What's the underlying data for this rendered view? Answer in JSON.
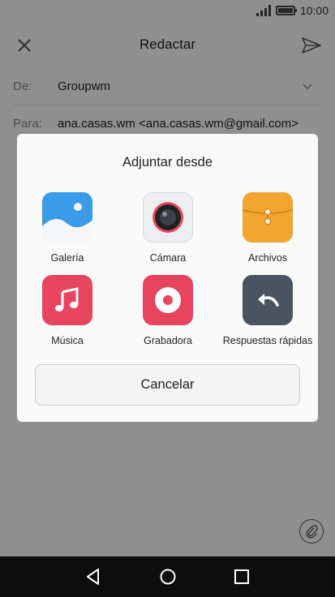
{
  "status_bar": {
    "time": "10:00"
  },
  "app_bar": {
    "title": "Redactar"
  },
  "fields": {
    "from_label": "De:",
    "from_value": "Groupwm",
    "to_label": "Para:",
    "to_value": "ana.casas.wm <ana.casas.wm@gmail.com>"
  },
  "dialog": {
    "title": "Adjuntar desde",
    "options": [
      {
        "label": "Galería",
        "icon": "gallery-icon"
      },
      {
        "label": "Cámara",
        "icon": "camera-icon"
      },
      {
        "label": "Archivos",
        "icon": "files-icon"
      },
      {
        "label": "Música",
        "icon": "music-icon"
      },
      {
        "label": "Grabadora",
        "icon": "recorder-icon"
      },
      {
        "label": "Respuestas rápidas",
        "icon": "quick-replies-icon"
      }
    ],
    "cancel_label": "Cancelar"
  },
  "colors": {
    "gallery": "#3a9be8",
    "music": "#e6445f",
    "recorder": "#e6445f",
    "files": "#f2a531",
    "quick_replies": "#4a5360"
  }
}
